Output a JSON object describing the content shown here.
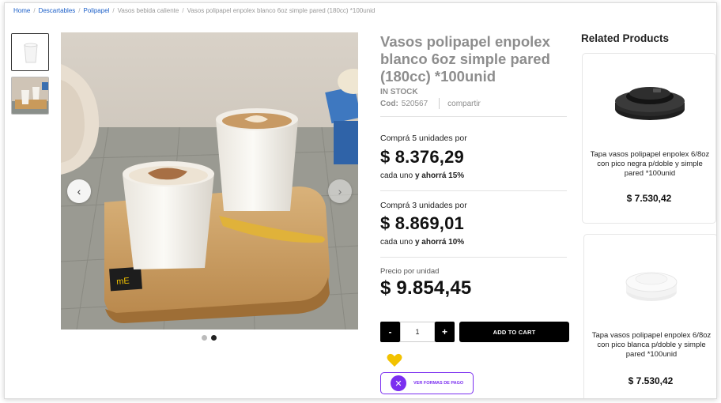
{
  "breadcrumb": [
    {
      "label": "Home",
      "link": true
    },
    {
      "label": "Descartables",
      "link": true
    },
    {
      "label": "Polipapel",
      "link": true
    },
    {
      "label": "Vasos bebida caliente",
      "link": false
    },
    {
      "label": "Vasos polipapel enpolex blanco 6oz simple pared (180cc) *100unid",
      "link": false
    }
  ],
  "gallery": {
    "thumbnails": [
      "cup-product-thumbnail",
      "cups-lifestyle-thumbnail"
    ],
    "active_index": 1,
    "dots_count": 2
  },
  "product": {
    "title": "Vasos polipapel enpolex blanco 6oz simple pared (180cc) *100unid",
    "stock": "IN STOCK",
    "code_label": "Cod:",
    "code": "520567",
    "share": "compartir"
  },
  "promos": [
    {
      "label": "Comprá 5 unidades por",
      "price": "$ 8.376,29",
      "sub_prefix": "cada uno",
      "sub_bold": "y ahorrá 15%"
    },
    {
      "label": "Comprá 3 unidades por",
      "price": "$ 8.869,01",
      "sub_prefix": "cada uno",
      "sub_bold": "y ahorrá 10%"
    }
  ],
  "unit": {
    "label": "Precio por unidad",
    "price": "$ 9.854,45"
  },
  "cart": {
    "minus": "-",
    "plus": "+",
    "quantity": "1",
    "add_label": "ADD TO CART"
  },
  "payment": {
    "icon_glyph": "✕",
    "label": "VER FORMAS DE PAGO",
    "accent": "#7b2ff0"
  },
  "wishlist_color": "#f2c200",
  "related": {
    "title": "Related Products",
    "items": [
      {
        "name": "Tapa vasos polipapel enpolex 6/8oz con pico negra p/doble y simple pared *100unid",
        "price": "$ 7.530,42"
      },
      {
        "name": "Tapa vasos polipapel enpolex 6/8oz con pico blanca p/doble y simple pared *100unid",
        "price": "$ 7.530,42"
      }
    ]
  }
}
